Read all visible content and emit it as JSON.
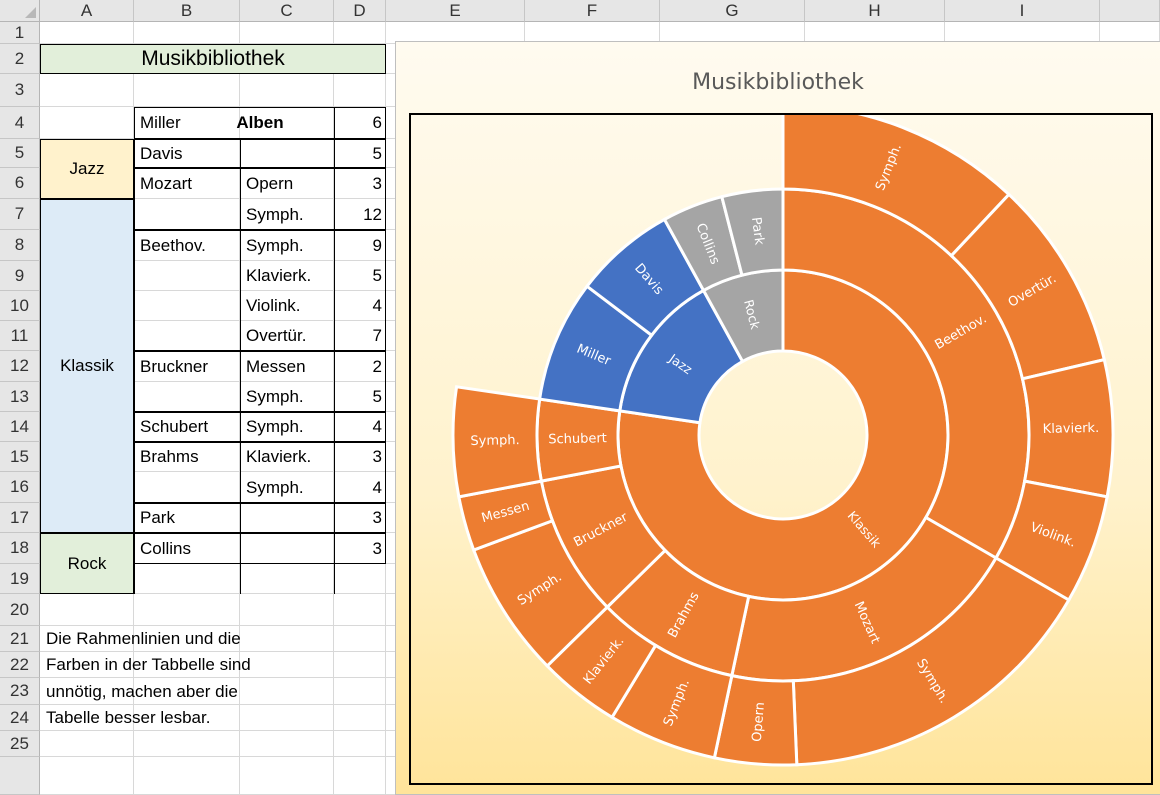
{
  "spreadsheet": {
    "columns": [
      "A",
      "B",
      "C",
      "D",
      "E",
      "F",
      "G",
      "H",
      "I"
    ],
    "rows": [
      "1",
      "2",
      "3",
      "4",
      "5",
      "6",
      "7",
      "8",
      "9",
      "10",
      "11",
      "12",
      "13",
      "14",
      "15",
      "16",
      "17",
      "18",
      "19",
      "20",
      "21",
      "22",
      "23",
      "24",
      "25"
    ],
    "title": "Musikbibliothek",
    "header_alben": "Alben",
    "genres": {
      "jazz": "Jazz",
      "klassik": "Klassik",
      "rock": "Rock"
    },
    "data_rows": [
      {
        "b": "Miller",
        "c": "",
        "d": "6"
      },
      {
        "b": "Davis",
        "c": "",
        "d": "5"
      },
      {
        "b": "Mozart",
        "c": "Opern",
        "d": "3"
      },
      {
        "b": "",
        "c": "Symph.",
        "d": "12"
      },
      {
        "b": "Beethov.",
        "c": "Symph.",
        "d": "9"
      },
      {
        "b": "",
        "c": "Klavierk.",
        "d": "5"
      },
      {
        "b": "",
        "c": "Violink.",
        "d": "4"
      },
      {
        "b": "",
        "c": "Overtür.",
        "d": "7"
      },
      {
        "b": "Bruckner",
        "c": "Messen",
        "d": "2"
      },
      {
        "b": "",
        "c": "Symph.",
        "d": "5"
      },
      {
        "b": "Schubert",
        "c": "Symph.",
        "d": "4"
      },
      {
        "b": "Brahms",
        "c": "Klavierk.",
        "d": "3"
      },
      {
        "b": "",
        "c": "Symph.",
        "d": "4"
      },
      {
        "b": "Park",
        "c": "",
        "d": "3"
      },
      {
        "b": "Collins",
        "c": "",
        "d": "3"
      }
    ],
    "note_lines": [
      "Die Rahmenlinien und die",
      "Farben in der Tabbelle sind",
      "unnötig, machen aber die",
      "Tabelle besser lesbar."
    ],
    "colors": {
      "title_fill": "#e2efda",
      "jazz_fill": "#fff2cc",
      "klassik_fill": "#ddebf7",
      "rock_fill": "#e2efda"
    }
  },
  "chart_data": {
    "type": "sunburst",
    "title": "Musikbibliothek",
    "colors": {
      "Klassik": "#ed7d31",
      "Jazz": "#4472c4",
      "Rock": "#a5a5a5"
    },
    "tree": [
      {
        "name": "Klassik",
        "children": [
          {
            "name": "Beethov.",
            "children": [
              {
                "name": "Symph.",
                "value": 9
              },
              {
                "name": "Overtür.",
                "value": 7
              },
              {
                "name": "Klavierk.",
                "value": 5
              },
              {
                "name": "Violink.",
                "value": 4
              }
            ]
          },
          {
            "name": "Mozart",
            "children": [
              {
                "name": "Symph.",
                "value": 12
              },
              {
                "name": "Opern",
                "value": 3
              }
            ]
          },
          {
            "name": "Brahms",
            "children": [
              {
                "name": "Symph.",
                "value": 4
              },
              {
                "name": "Klavierk.",
                "value": 3
              }
            ]
          },
          {
            "name": "Bruckner",
            "children": [
              {
                "name": "Symph.",
                "value": 5
              },
              {
                "name": "Messen",
                "value": 2
              }
            ]
          },
          {
            "name": "Schubert",
            "children": [
              {
                "name": "Symph.",
                "value": 4
              }
            ]
          }
        ]
      },
      {
        "name": "Jazz",
        "children": [
          {
            "name": "Miller",
            "value": 6
          },
          {
            "name": "Davis",
            "value": 5
          }
        ]
      },
      {
        "name": "Rock",
        "children": [
          {
            "name": "Collins",
            "value": 3
          },
          {
            "name": "Park",
            "value": 3
          }
        ]
      }
    ]
  }
}
